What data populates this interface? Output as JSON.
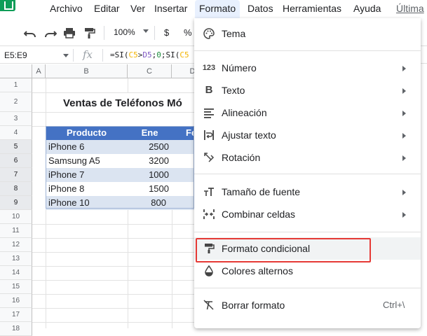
{
  "menubar": {
    "items": [
      "Archivo",
      "Editar",
      "Ver",
      "Insertar",
      "Formato",
      "Datos",
      "Herramientas",
      "Ayuda"
    ],
    "last_edit": "Última"
  },
  "toolbar": {
    "zoom": "100%",
    "currency": "$",
    "percent": "%"
  },
  "formula_bar": {
    "name_box": "E5:E9",
    "fx": "fx",
    "formula_prefix": "=SI(",
    "ref1": "C5",
    "op": ">",
    "ref2": "D5",
    "sep": ";",
    "zero": "0",
    "sep2": ";SI(",
    "ref3": "C5"
  },
  "grid": {
    "columns": [
      "A",
      "B",
      "C",
      "D"
    ],
    "rows": [
      "1",
      "2",
      "3",
      "4",
      "5",
      "6",
      "7",
      "8",
      "9",
      "10",
      "11",
      "12",
      "13",
      "14",
      "15",
      "16",
      "17",
      "18"
    ],
    "title": "Ventas de Teléfonos Mó",
    "headers": [
      "Producto",
      "Ene",
      "Fe"
    ],
    "data": [
      {
        "product": "iPhone 6",
        "ene": "2500"
      },
      {
        "product": "Samsung A5",
        "ene": "3200"
      },
      {
        "product": "iPhone 7",
        "ene": "1000"
      },
      {
        "product": "iPhone 8",
        "ene": "1500"
      },
      {
        "product": "iPhone 10",
        "ene": "800"
      }
    ]
  },
  "format_menu": {
    "items": [
      {
        "label": "Tema",
        "icon": "palette-icon"
      },
      {
        "label": "Número",
        "icon": "number-format-icon"
      },
      {
        "label": "Texto",
        "icon": "bold-icon"
      },
      {
        "label": "Alineación",
        "icon": "align-icon"
      },
      {
        "label": "Ajustar texto",
        "icon": "wrap-icon"
      },
      {
        "label": "Rotación",
        "icon": "rotate-icon"
      },
      {
        "label": "Tamaño de fuente",
        "icon": "font-size-icon"
      },
      {
        "label": "Combinar celdas",
        "icon": "merge-icon"
      },
      {
        "label": "Formato condicional",
        "icon": "paint-roller-icon"
      },
      {
        "label": "Colores alternos",
        "icon": "fill-drop-icon"
      },
      {
        "label": "Borrar formato",
        "icon": "clear-format-icon",
        "shortcut": "Ctrl+\\"
      }
    ]
  },
  "colors": {
    "table_header": "#4472c4",
    "table_band": "#dbe4f1",
    "highlight": "#e53935",
    "menu_active": "#e8f0fe"
  }
}
